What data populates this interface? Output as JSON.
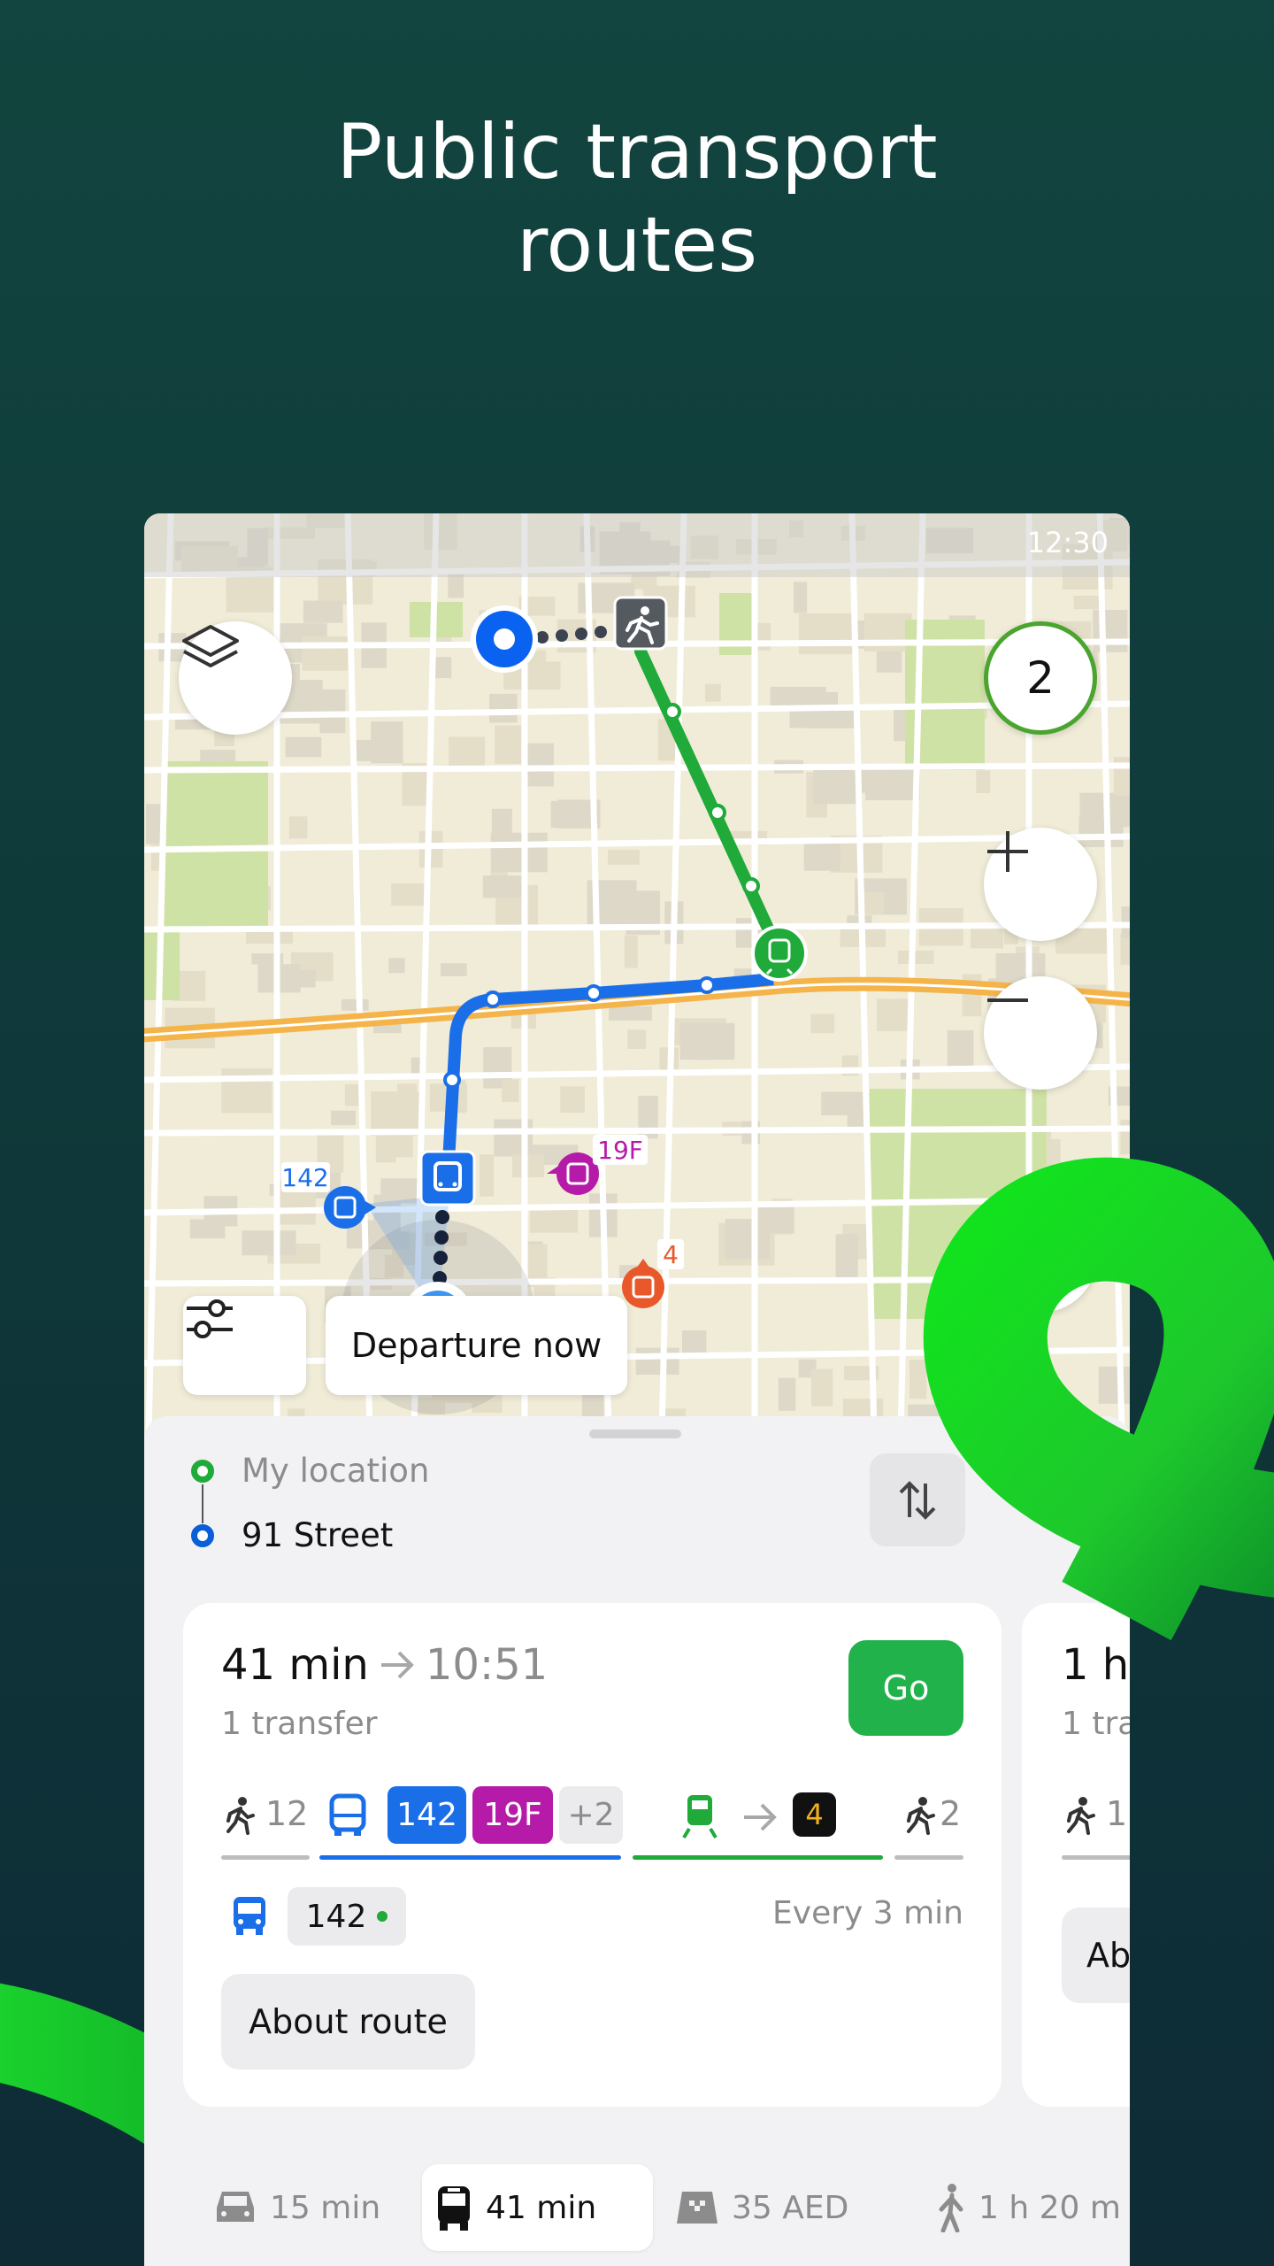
{
  "headline": {
    "line1": "Public transport",
    "line2": "routes"
  },
  "status_bar": {
    "time": "12:30"
  },
  "map": {
    "route_count": "2",
    "departure_label": "Departure now",
    "stop_labels": {
      "bus_142": "142",
      "trolley_19f": "19F",
      "tram_4": "4"
    },
    "icons": [
      "layers-icon",
      "plus-icon",
      "minus-icon",
      "compass-icon",
      "filter-icon",
      "walk-icon",
      "bus-icon",
      "train-icon"
    ],
    "colors": {
      "walk_line": "#1faa3a",
      "bus_line": "#1a6fe8",
      "highway": "#f4b44a",
      "accent": "#22b24c"
    }
  },
  "route_points": {
    "from": "My location",
    "to": "91 Street"
  },
  "routes": [
    {
      "duration": "41 min",
      "arrival": "10:51",
      "transfers": "1 transfer",
      "go_label": "Go",
      "segments": {
        "walk_start": "12",
        "bus_badges": [
          {
            "label": "142",
            "color": "#1a6fe8"
          },
          {
            "label": "19F",
            "color": "#b61aa8"
          },
          {
            "label": "+2",
            "color": "#ebebed"
          }
        ],
        "tram_badge": "4",
        "walk_end": "2"
      },
      "next_bus": "142",
      "frequency": "Every 3 min",
      "about_label": "About route"
    },
    {
      "duration": "1 h",
      "transfers": "1 tra",
      "walk_start": "1",
      "about_label": "Ab"
    }
  ],
  "modes": [
    {
      "icon": "car-icon",
      "label": "15 min",
      "active": false
    },
    {
      "icon": "bus-icon",
      "label": "41 min",
      "active": true
    },
    {
      "icon": "taxi-icon",
      "label": "35 AED",
      "active": false
    },
    {
      "icon": "walk-icon",
      "label": "1 h 20 m",
      "active": false
    }
  ]
}
